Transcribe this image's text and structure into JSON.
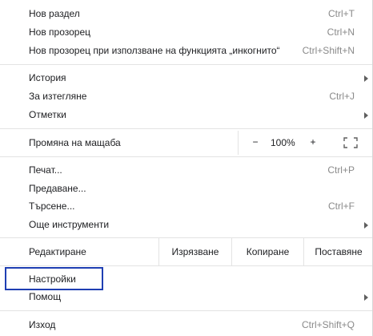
{
  "menu": {
    "new_tab": {
      "label": "Нов раздел",
      "shortcut": "Ctrl+T"
    },
    "new_window": {
      "label": "Нов прозорец",
      "shortcut": "Ctrl+N"
    },
    "incognito": {
      "label": "Нов прозорец при използване на функцията „инкогнито“",
      "shortcut": "Ctrl+Shift+N"
    },
    "history": {
      "label": "История"
    },
    "downloads": {
      "label": "За изтегляне",
      "shortcut": "Ctrl+J"
    },
    "bookmarks": {
      "label": "Отметки"
    },
    "zoom": {
      "label": "Промяна на мащаба",
      "minus": "−",
      "value": "100%",
      "plus": "+"
    },
    "print": {
      "label": "Печат...",
      "shortcut": "Ctrl+P"
    },
    "cast": {
      "label": "Предаване..."
    },
    "find": {
      "label": "Търсене...",
      "shortcut": "Ctrl+F"
    },
    "more_tools": {
      "label": "Още инструменти"
    },
    "edit": {
      "label": "Редактиране",
      "cut": "Изрязване",
      "copy": "Копиране",
      "paste": "Поставяне"
    },
    "settings": {
      "label": "Настройки"
    },
    "help": {
      "label": "Помощ"
    },
    "exit": {
      "label": "Изход",
      "shortcut": "Ctrl+Shift+Q"
    }
  },
  "colors": {
    "highlight_border": "#1f3fb3",
    "separator": "#e3e3e3",
    "shortcut_text": "#8a8a8a"
  },
  "icons": {
    "submenu_arrow": "chevron-right-icon",
    "fullscreen": "fullscreen-icon"
  }
}
